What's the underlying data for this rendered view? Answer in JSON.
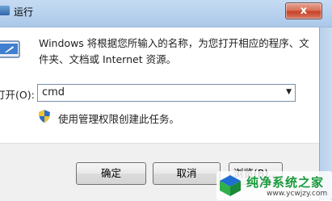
{
  "window": {
    "title": "运行",
    "close_label": "x"
  },
  "description": "Windows 将根据您所输入的名称，为您打开相应的程序、文件夹、文档或 Internet 资源。",
  "open_field": {
    "label": "打开(O):",
    "value": "cmd"
  },
  "admin_note": "使用管理权限创建此任务。",
  "buttons": {
    "ok": "确定",
    "cancel": "取消",
    "browse": "浏览(B)..."
  },
  "watermark": {
    "title": "纯净系统之家",
    "url": "www.ycwjzy.com"
  },
  "icons": {
    "title": "run-icon",
    "dialog": "run-icon",
    "uac": "shield-icon",
    "dropdown": "chevron-down-icon",
    "logo": "logo-icon"
  },
  "colors": {
    "titlebar": "#b7d1ee",
    "close": "#c5432a",
    "watermark_green": "#1a9a3c",
    "watermark_blue": "#1f6fd1"
  }
}
